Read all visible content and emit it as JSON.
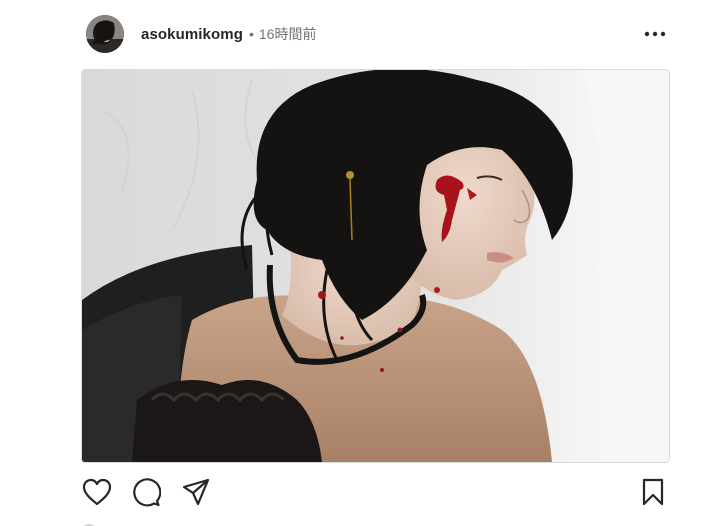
{
  "post": {
    "username": "asokumikomg",
    "separator": "•",
    "time_ago": "16時間前"
  },
  "icons": {
    "more": "more-horizontal-icon",
    "like": "heart-icon",
    "comment": "comment-bubble-icon",
    "share": "paper-plane-icon",
    "save": "bookmark-icon"
  },
  "colors": {
    "text_primary": "#262626",
    "text_secondary": "#737373",
    "border": "#dbdbdb"
  }
}
